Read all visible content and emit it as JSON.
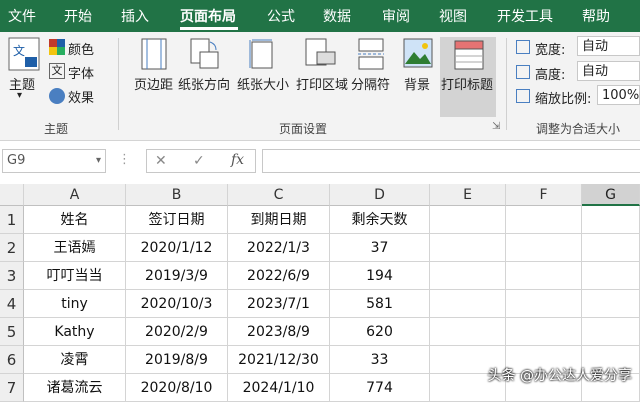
{
  "tabs": [
    {
      "label": "文件"
    },
    {
      "label": "开始"
    },
    {
      "label": "插入"
    },
    {
      "label": "页面布局"
    },
    {
      "label": "公式"
    },
    {
      "label": "数据"
    },
    {
      "label": "审阅"
    },
    {
      "label": "视图"
    },
    {
      "label": "开发工具"
    },
    {
      "label": "帮助"
    }
  ],
  "ribbon": {
    "theme_group": {
      "theme": "主题",
      "colors": "颜色",
      "fonts": "字体",
      "effects": "效果",
      "label": "主题"
    },
    "page_setup_group": {
      "buttons": [
        "页边距",
        "纸张方向",
        "纸张大小",
        "打印区域",
        "分隔符",
        "背景",
        "打印标题"
      ],
      "label": "页面设置"
    },
    "scale_group": {
      "width_label": "宽度:",
      "width_value": "自动",
      "height_label": "高度:",
      "height_value": "自动",
      "scale_label": "缩放比例:",
      "scale_value": "100%",
      "label": "调整为合适大小"
    }
  },
  "formula_bar": {
    "name_box": "G9",
    "cancel": "✕",
    "enter": "✓",
    "fx": "fx"
  },
  "sheet": {
    "columns": [
      "A",
      "B",
      "C",
      "D",
      "E",
      "F",
      "G"
    ],
    "rows": [
      "1",
      "2",
      "3",
      "4",
      "5",
      "6",
      "7"
    ],
    "data": [
      [
        "姓名",
        "签订日期",
        "到期日期",
        "剩余天数"
      ],
      [
        "王语嫣",
        "2020/1/12",
        "2022/1/3",
        "37"
      ],
      [
        "叮叮当当",
        "2019/3/9",
        "2022/6/9",
        "194"
      ],
      [
        "tiny",
        "2020/10/3",
        "2023/7/1",
        "581"
      ],
      [
        "Kathy",
        "2020/2/9",
        "2023/8/9",
        "620"
      ],
      [
        "凌霄",
        "2019/8/9",
        "2021/12/30",
        "33"
      ],
      [
        "诸葛流云",
        "2020/8/10",
        "2024/1/10",
        "774"
      ]
    ]
  },
  "watermark": "头条 @办公达人爱分享",
  "colors": {
    "accent": "#217346"
  }
}
